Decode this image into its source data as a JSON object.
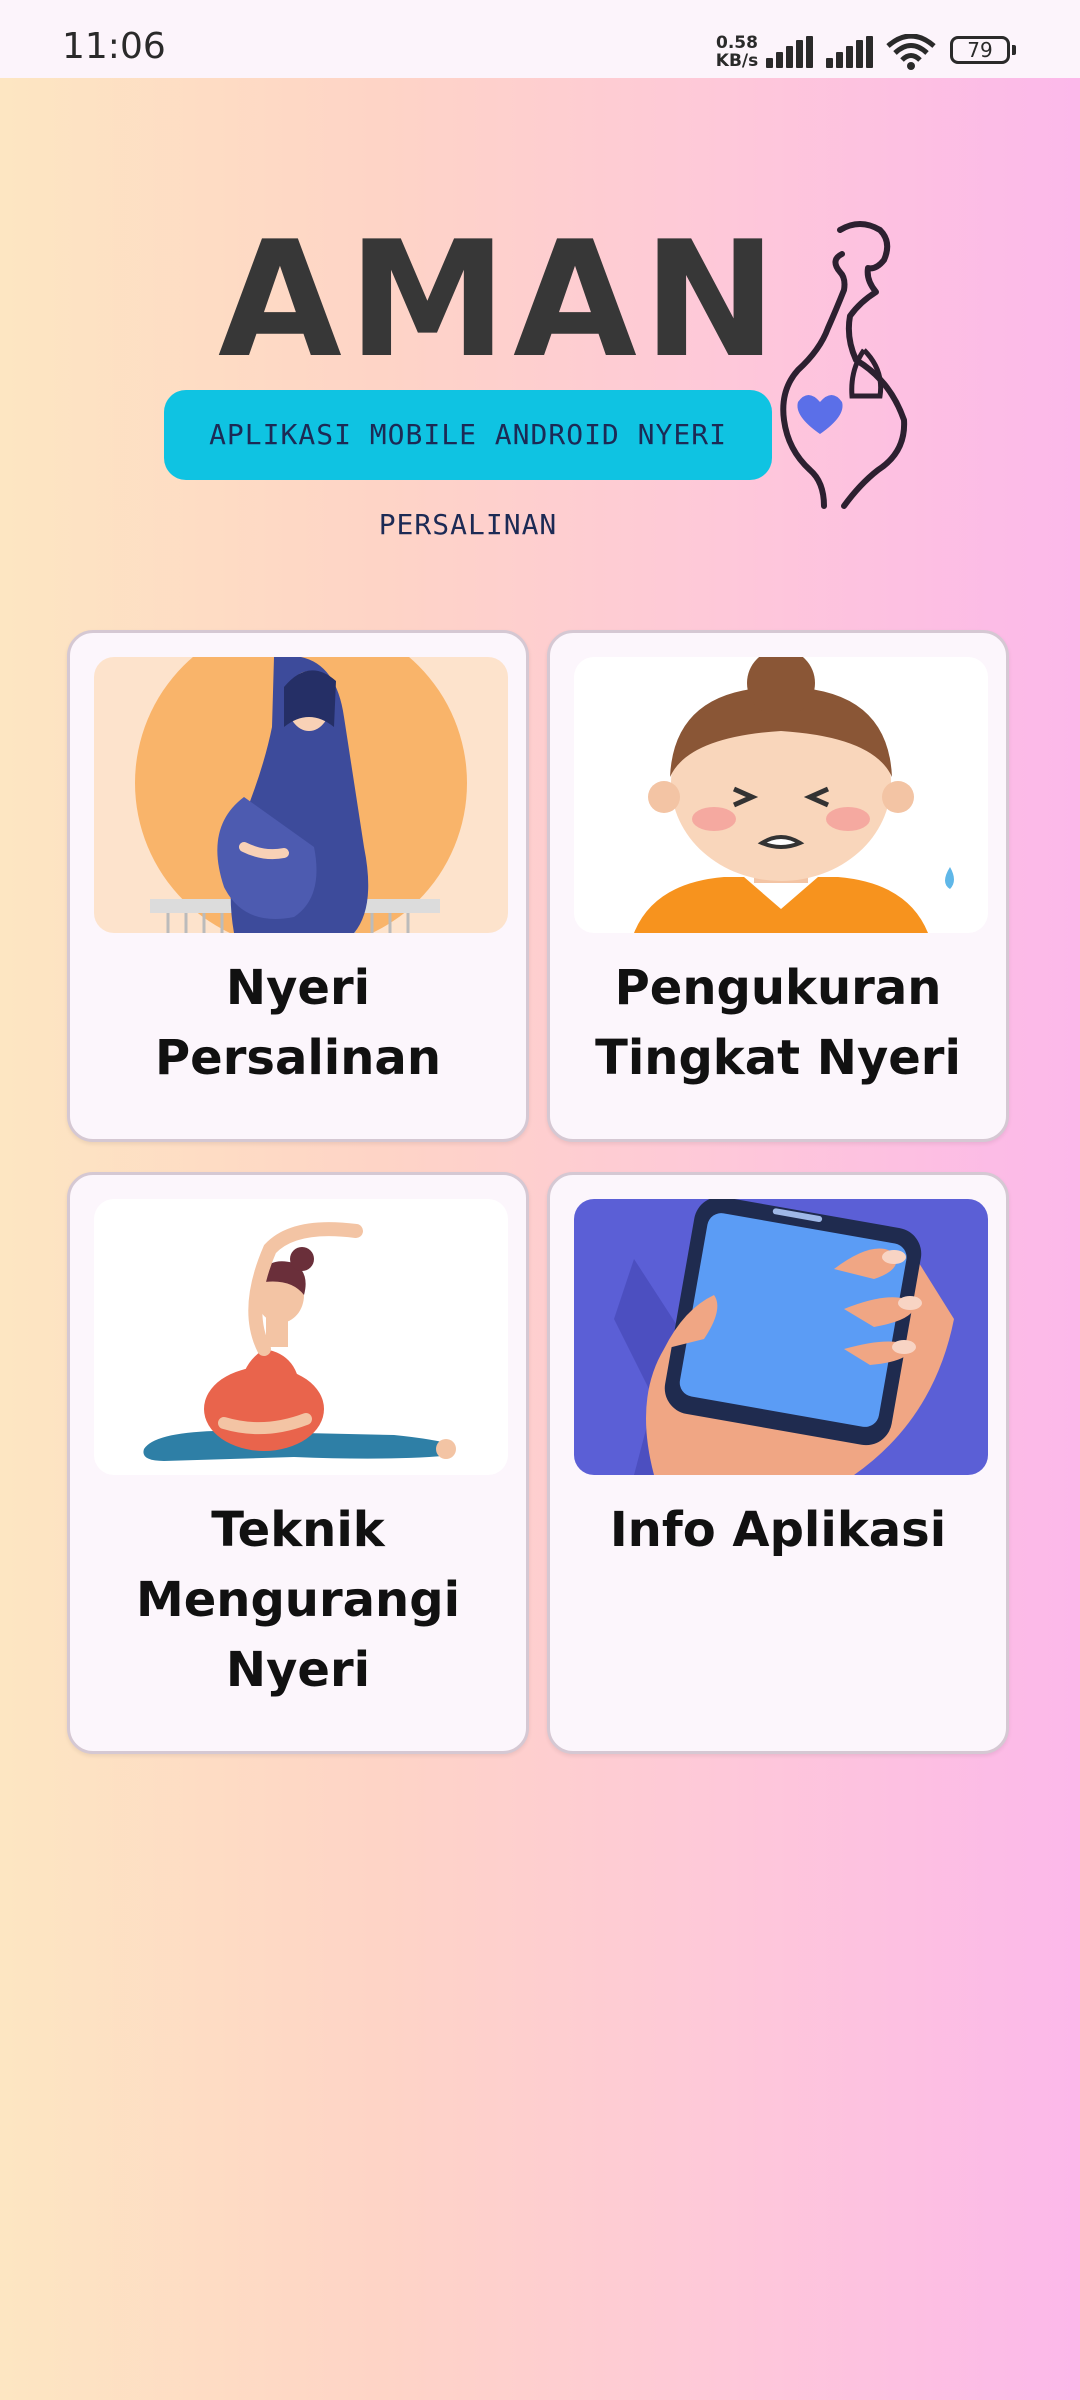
{
  "status_bar": {
    "time": "11:06",
    "net_speed_value": "0.58",
    "net_speed_unit": "KB/s",
    "battery": "79"
  },
  "logo": {
    "title": "AMAN",
    "subtitle": "APLIKASI MOBILE ANDROID NYERI PERSALINAN",
    "icon": "pregnant-woman-heart-icon"
  },
  "menu": {
    "items": [
      {
        "label_line1": "Nyeri",
        "label_line2": "Persalinan",
        "illustration": "pregnant-woman-hijab"
      },
      {
        "label_line1": "Pengukuran",
        "label_line2": "Tingkat Nyeri",
        "illustration": "woman-in-pain-face"
      },
      {
        "label_line1": "Teknik",
        "label_line2": "Mengurangi",
        "label_line3": "Nyeri",
        "illustration": "pregnant-woman-yoga-stretch"
      },
      {
        "label_line1": "Info Aplikasi",
        "illustration": "hand-holding-phone"
      }
    ]
  },
  "colors": {
    "background_start": "#fde6c2",
    "background_end": "#fcb8ea",
    "card_bg": "#fcf6fc",
    "logo_band": "#0fc3e2",
    "logo_text": "#373737"
  }
}
